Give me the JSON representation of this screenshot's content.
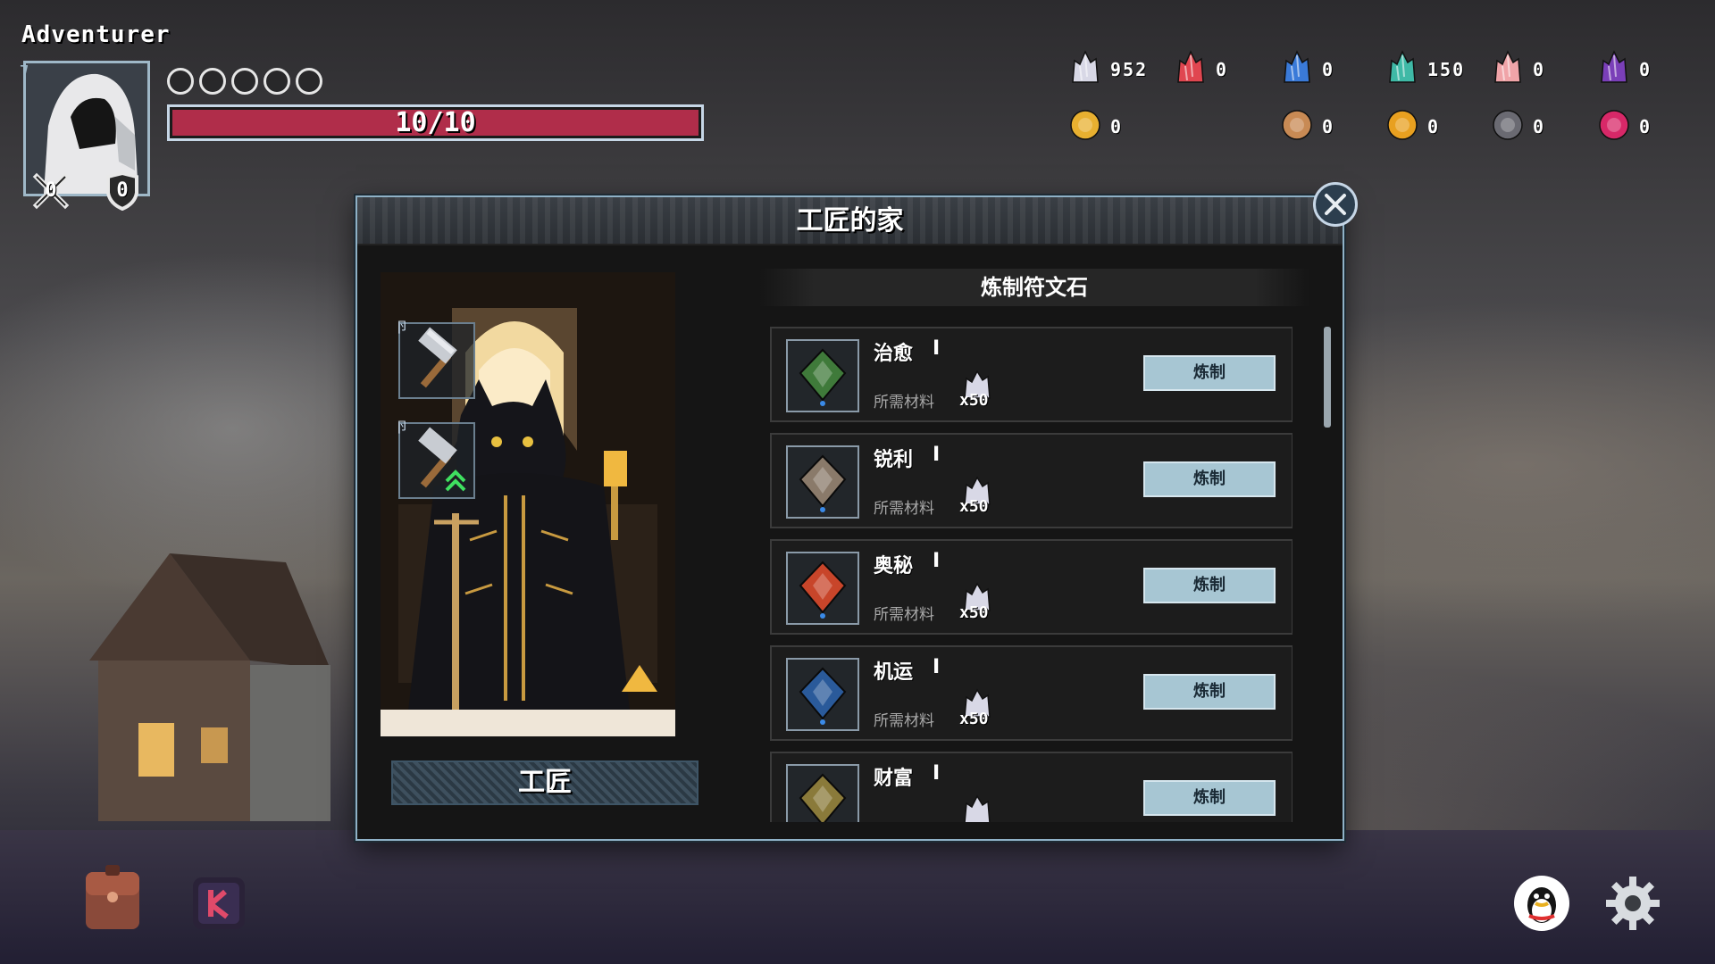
{
  "player": {
    "name": "Adventurer",
    "portrait_corner": "⁊",
    "attack": "0",
    "defense": "0",
    "orbs_total": 5,
    "hp_text": "10/10",
    "hp_fraction": 1.0
  },
  "resources": {
    "row1": [
      {
        "icon": "white-crystal-icon",
        "color": "#d8d8e6",
        "count": "952"
      },
      {
        "icon": "red-crystal-icon",
        "color": "#e04650",
        "count": "0"
      },
      {
        "icon": "blue-crystal-icon",
        "color": "#3a7ad8",
        "count": "0"
      },
      {
        "icon": "teal-crystal-icon",
        "color": "#3fb9a6",
        "count": "150"
      },
      {
        "icon": "pink-crystal-icon",
        "color": "#f0a4a8",
        "count": "0"
      },
      {
        "icon": "purple-crystal-icon",
        "color": "#7a3fb8",
        "count": "0"
      }
    ],
    "row2": [
      {
        "icon": "gold-nugget-icon",
        "color": "#e8b030",
        "count": "0"
      },
      {
        "icon": "scroll-rune-icon",
        "color": "#c88a54",
        "count": "0"
      },
      {
        "icon": "gold-coin-icon",
        "color": "#e8a020",
        "count": "0"
      },
      {
        "icon": "dark-ore-icon",
        "color": "#6a6a72",
        "count": "0"
      },
      {
        "icon": "star-orb-icon",
        "color": "#d82868",
        "count": "0"
      }
    ]
  },
  "modal": {
    "title": "工匠的家",
    "section_title": "炼制符文石",
    "npc_label": "工匠",
    "tool_slots": [
      {
        "index": "卪",
        "icon": "hammer-icon"
      },
      {
        "index": "卪",
        "icon": "hammer-upgrade-icon"
      }
    ],
    "recipes": [
      {
        "name": "治愈",
        "level": "I",
        "req_label": "所需材料",
        "qty": "x50",
        "button": "炼制",
        "icon": "healing-rune-icon",
        "tint": "#3f7a3a"
      },
      {
        "name": "锐利",
        "level": "I",
        "req_label": "所需材料",
        "qty": "x50",
        "button": "炼制",
        "icon": "sharp-rune-icon",
        "tint": "#8a7a6a"
      },
      {
        "name": "奥秘",
        "level": "I",
        "req_label": "所需材料",
        "qty": "x50",
        "button": "炼制",
        "icon": "arcane-rune-icon",
        "tint": "#c8452a"
      },
      {
        "name": "机运",
        "level": "I",
        "req_label": "所需材料",
        "qty": "x50",
        "button": "炼制",
        "icon": "fortune-rune-icon",
        "tint": "#2a5a9a"
      },
      {
        "name": "财富",
        "level": "I",
        "req_label": "",
        "qty": "",
        "button": "炼制",
        "icon": "wealth-rune-icon",
        "tint": "#8a7a3a"
      }
    ]
  }
}
